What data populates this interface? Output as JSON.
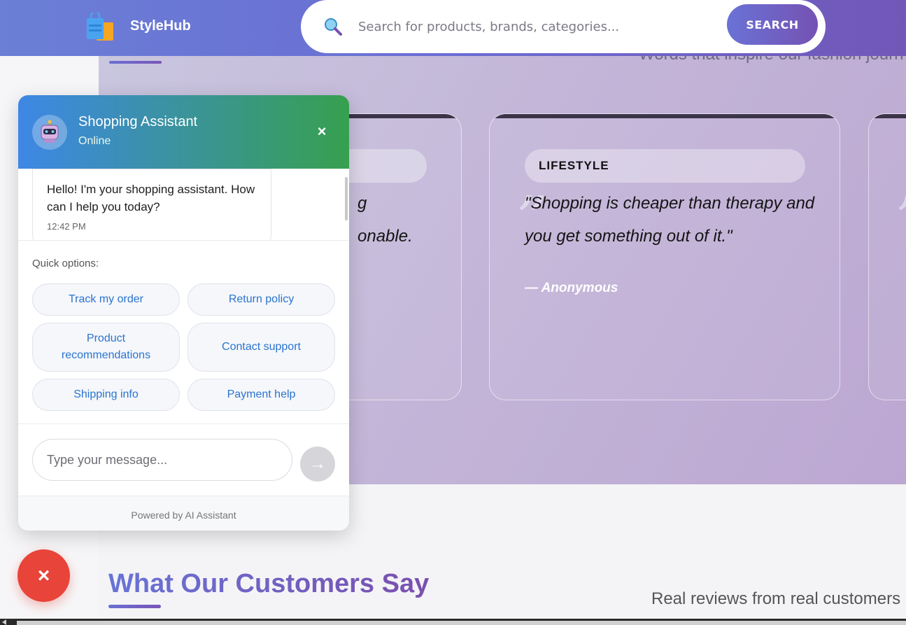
{
  "header": {
    "brand": "StyleHub",
    "search_placeholder": "Search for products, brands, categories...",
    "search_button": "SEARCH"
  },
  "quotes": {
    "subtitle": "Words that inspire our fashion journ",
    "cards": [
      {
        "tag": "",
        "line1": "g",
        "line2": "onable.",
        "author": ""
      },
      {
        "tag": "LIFESTYLE",
        "quote": "\"Shopping is cheaper than therapy and you get something out of it.\"",
        "author": "— Anonymous"
      }
    ]
  },
  "chat": {
    "title": "Shopping Assistant",
    "status": "Online",
    "close_label": "×",
    "message": {
      "text": "Hello! I'm your shopping assistant. How can I help you today?",
      "time": "12:42 PM"
    },
    "quick_label": "Quick options:",
    "quick_options": [
      "Track my order",
      "Return policy",
      "Product recommendations",
      "Contact support",
      "Shipping info",
      "Payment help"
    ],
    "input_placeholder": "Type your message...",
    "send_label": "→",
    "footer": "Powered by AI Assistant"
  },
  "fab": {
    "label": "×"
  },
  "customers": {
    "title": "What Our Customers Say",
    "subtitle": "Real reviews from real customers"
  },
  "colors": {
    "header_start": "#6b7fd6",
    "header_end": "#7257b8",
    "chat_header_start": "#3e87e6",
    "chat_header_end": "#36a04f",
    "quick_text": "#2a73d0",
    "fab": "#e8443a"
  },
  "icons": {
    "logo": "shopping-bags-icon",
    "search": "magnifier-icon",
    "bot": "robot-icon",
    "close": "close-icon",
    "send": "arrow-right-icon"
  }
}
